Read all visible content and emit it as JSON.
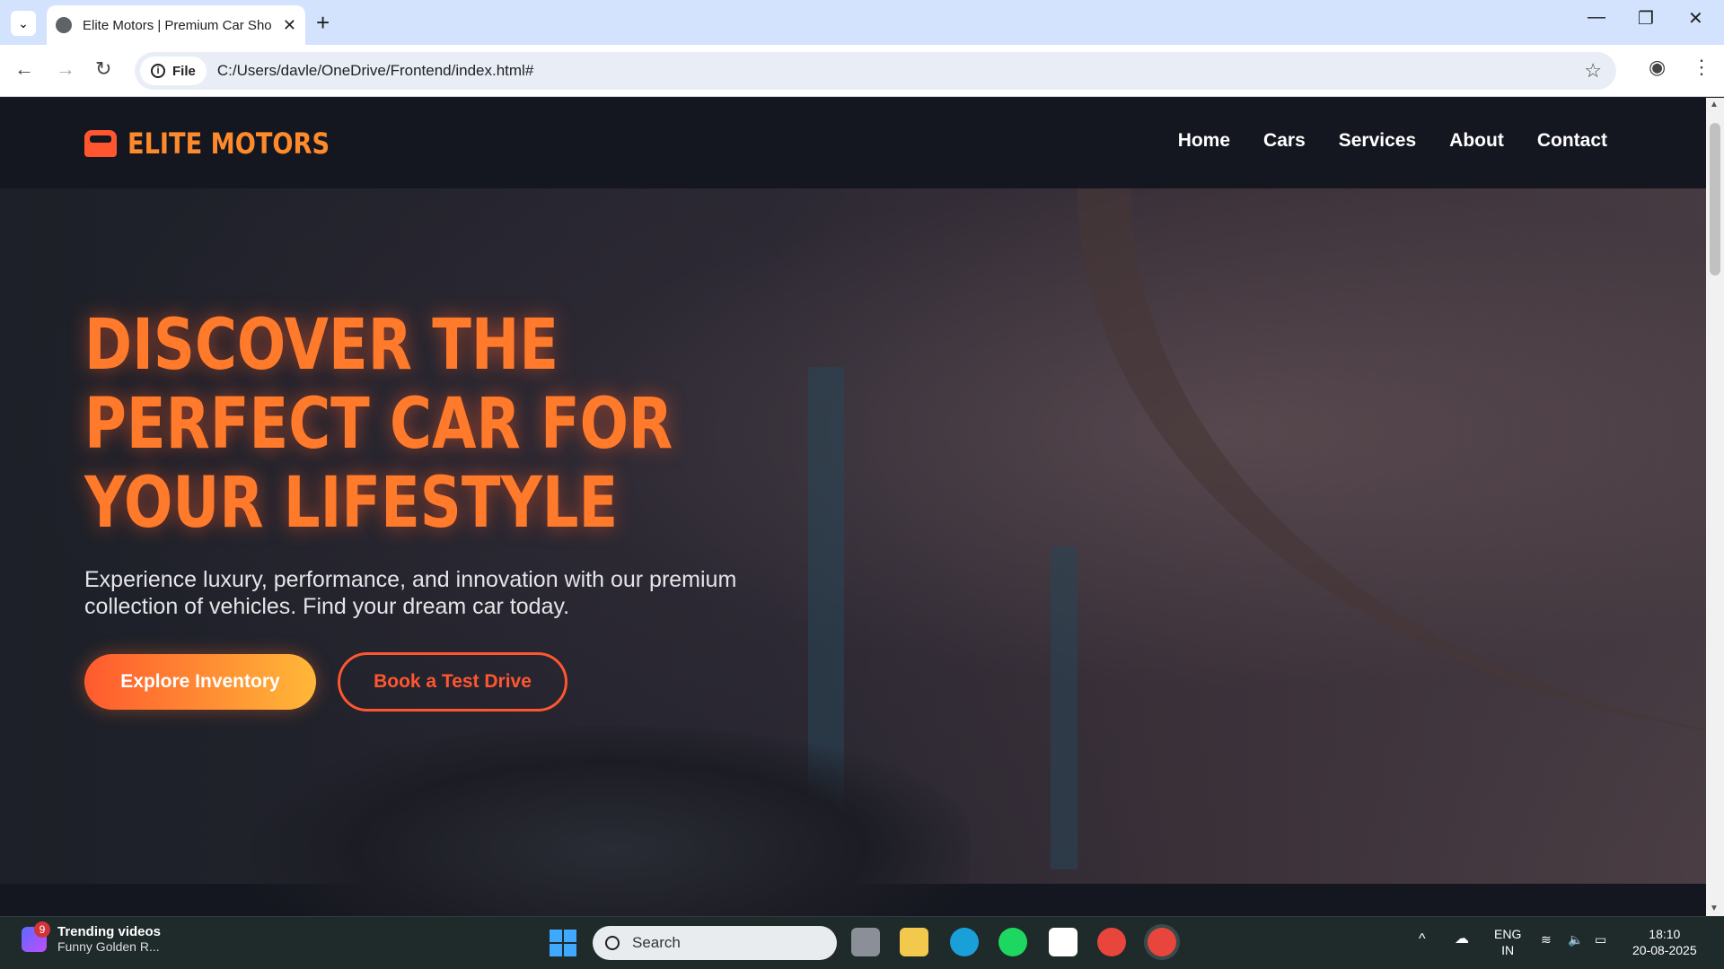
{
  "browser": {
    "tab_title": "Elite Motors | Premium Car Sho",
    "address_chip": "File",
    "url": "C:/Users/davle/OneDrive/Frontend/index.html#"
  },
  "site": {
    "logo_text": "ELITE MOTORS",
    "nav": [
      "Home",
      "Cars",
      "Services",
      "About",
      "Contact"
    ],
    "hero_title": "DISCOVER THE PERFECT CAR FOR YOUR LIFESTYLE",
    "hero_subtitle": "Experience luxury, performance, and innovation with our premium collection of vehicles. Find your dream car today.",
    "primary_cta": "Explore Inventory",
    "secondary_cta": "Book a Test Drive"
  },
  "taskbar": {
    "widget_badge": "9",
    "widget_title": "Trending videos",
    "widget_subtitle": "Funny Golden R...",
    "search_label": "Search",
    "lang_line1": "ENG",
    "lang_line2": "IN",
    "time": "18:10",
    "date": "20-08-2025"
  },
  "colors": {
    "accent": "#ff5630",
    "accent_gradient_end": "#ffb838",
    "nav_bg": "#151720"
  }
}
